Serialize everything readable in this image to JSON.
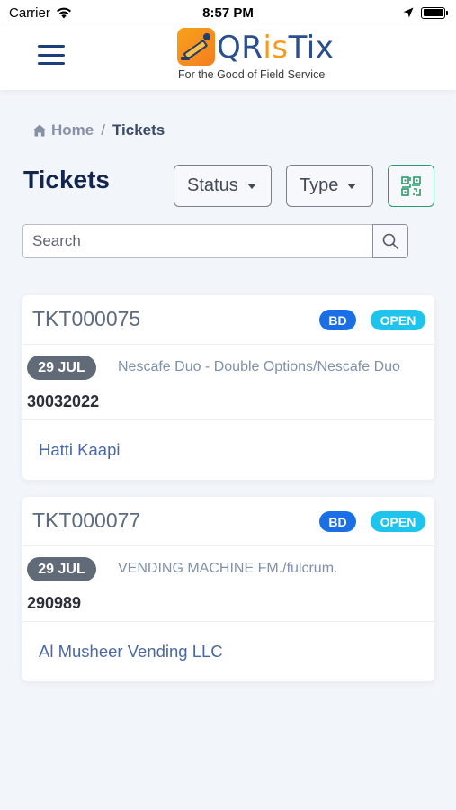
{
  "status_bar": {
    "carrier": "Carrier",
    "time": "8:57 PM"
  },
  "header": {
    "logo_text_part1": "QR",
    "logo_text_part2": "is",
    "logo_text_part3": "Tix",
    "tagline": "For the Good of Field Service",
    "brand_blue": "#2a4f8e",
    "brand_orange": "#f59b1e"
  },
  "breadcrumb": {
    "home": "Home",
    "separator": "/",
    "current": "Tickets"
  },
  "page": {
    "title": "Tickets"
  },
  "filters": {
    "status_label": "Status",
    "type_label": "Type"
  },
  "search": {
    "placeholder": "Search",
    "value": ""
  },
  "tickets": [
    {
      "id": "TKT000075",
      "category_badge": "BD",
      "status_badge": "OPEN",
      "date": "29 JUL",
      "product": "Nescafe Duo - Double Options/Nescafe Duo",
      "serial": "30032022",
      "customer": "Hatti Kaapi"
    },
    {
      "id": "TKT000077",
      "category_badge": "BD",
      "status_badge": "OPEN",
      "date": "29 JUL",
      "product": "VENDING MACHINE FM./fulcrum.",
      "serial": "290989",
      "customer": "Al Musheer Vending LLC"
    }
  ],
  "colors": {
    "badge_bd": "#1a6fe6",
    "badge_open": "#1ec4ec",
    "date_pill": "#616b77",
    "qr_accent": "#2a9a6a"
  }
}
